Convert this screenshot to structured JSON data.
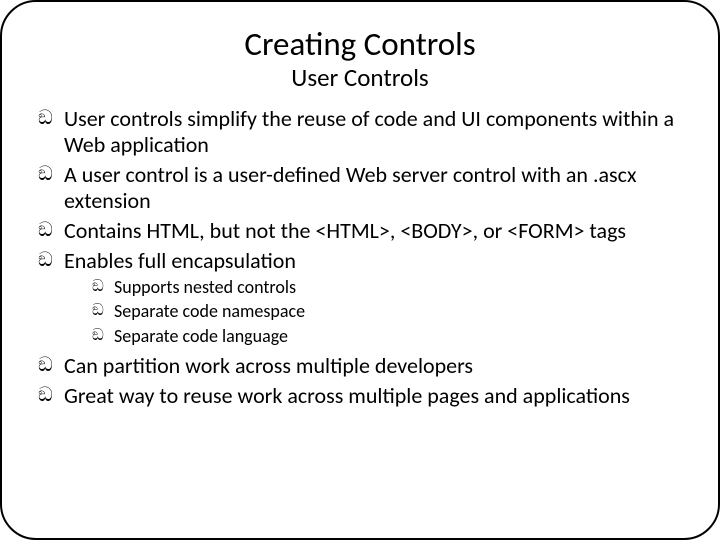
{
  "title": "Creating Controls",
  "subtitle": "User Controls",
  "bullets": {
    "b0": "User controls simplify the reuse of code and UI components within a Web application",
    "b1": "A user control is a user-defined Web server control with an .ascx extension",
    "b2": "Contains HTML, but not the <HTML>, <BODY>, or <FORM> tags",
    "b3": "Enables full encapsulation",
    "b4": "Can partition work across multiple developers",
    "b5": "Great way to reuse work across multiple pages and applications"
  },
  "sub": {
    "s0": "Supports nested controls",
    "s1": "Separate code namespace",
    "s2": "Separate code language"
  },
  "glyph": "ඞ"
}
